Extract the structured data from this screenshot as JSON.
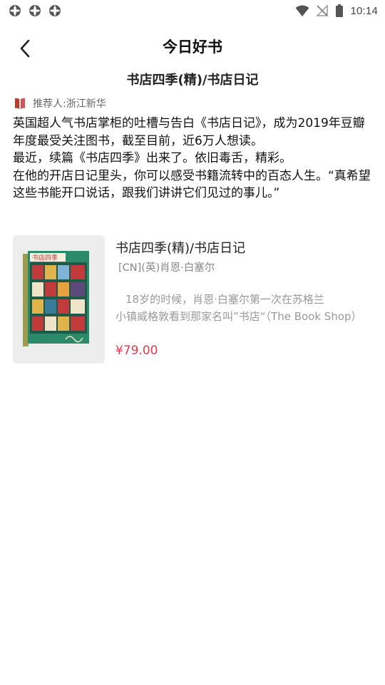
{
  "status_bar": {
    "time": "10:14",
    "left_icons": [
      "sync-icon",
      "sync-icon",
      "sync-icon"
    ],
    "right_icons": [
      "wifi-icon",
      "no-signal-icon",
      "battery-icon"
    ]
  },
  "header": {
    "title": "今日好书",
    "back_icon": "back-arrow-icon"
  },
  "article": {
    "title": "书店四季(精)/书店日记",
    "recommender_label": "推荐人:",
    "recommender_name": "浙江新华",
    "paragraphs": [
      "英国超人气书店掌柜的吐槽与告白《书店日记》，成为2019年豆瓣年度最受关注图书，截至目前，近6万人想读。",
      "最近，续篇《书店四季》出来了。依旧毒舌，精彩。",
      "在他的开店日记里头，你可以感受书籍流转中的百态人生。“真希望这些书能开口说话，跟我们讲讲它们见过的事儿。”"
    ]
  },
  "book": {
    "title": "书店四季(精)/书店日记",
    "author": "[CN](英)肖恩·白塞尔",
    "description_line1": "18岁的时候，肖恩·白塞尔第一次在苏格兰",
    "description_line2": "小镇威格敦看到那家名叫”书店“（The Book Shop）",
    "price": "¥79.00",
    "cover_title": "书店四季",
    "colors": {
      "price": "#e23a4b",
      "cover_green": "#2b8a6a",
      "cover_red": "#c23a3a"
    }
  }
}
